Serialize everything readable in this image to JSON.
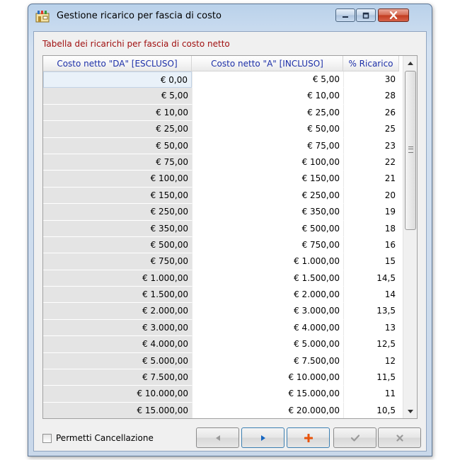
{
  "window": {
    "title": "Gestione ricarico per fascia di costo"
  },
  "caption": "Tabella dei ricarichi per fascia di costo netto",
  "table": {
    "columns": [
      "Costo netto \"DA\" [ESCLUSO]",
      "Costo netto \"A\" [INCLUSO]",
      "% Ricarico"
    ],
    "rows": [
      [
        "€ 0,00",
        "€ 5,00",
        "30"
      ],
      [
        "€ 5,00",
        "€ 10,00",
        "28"
      ],
      [
        "€ 10,00",
        "€ 25,00",
        "26"
      ],
      [
        "€ 25,00",
        "€ 50,00",
        "25"
      ],
      [
        "€ 50,00",
        "€ 75,00",
        "23"
      ],
      [
        "€ 75,00",
        "€ 100,00",
        "22"
      ],
      [
        "€ 100,00",
        "€ 150,00",
        "21"
      ],
      [
        "€ 150,00",
        "€ 250,00",
        "20"
      ],
      [
        "€ 250,00",
        "€ 350,00",
        "19"
      ],
      [
        "€ 350,00",
        "€ 500,00",
        "18"
      ],
      [
        "€ 500,00",
        "€ 750,00",
        "16"
      ],
      [
        "€ 750,00",
        "€ 1.000,00",
        "15"
      ],
      [
        "€ 1.000,00",
        "€ 1.500,00",
        "14,5"
      ],
      [
        "€ 1.500,00",
        "€ 2.000,00",
        "14"
      ],
      [
        "€ 2.000,00",
        "€ 3.000,00",
        "13,5"
      ],
      [
        "€ 3.000,00",
        "€ 4.000,00",
        "13"
      ],
      [
        "€ 4.000,00",
        "€ 5.000,00",
        "12,5"
      ],
      [
        "€ 5.000,00",
        "€ 7.500,00",
        "12"
      ],
      [
        "€ 7.500,00",
        "€ 10.000,00",
        "11,5"
      ],
      [
        "€ 10.000,00",
        "€ 15.000,00",
        "11"
      ],
      [
        "€ 15.000,00",
        "€ 20.000,00",
        "10,5"
      ]
    ]
  },
  "checkbox": {
    "label": "Permetti Cancellazione",
    "checked": false
  },
  "nav": {
    "icons": [
      "arrow-left-icon",
      "arrow-right-icon",
      "plus-icon",
      "check-icon",
      "x-icon"
    ],
    "colors": {
      "next": "#1565c0",
      "add": "#e8540c",
      "disabled": "#9a9a9a"
    }
  }
}
